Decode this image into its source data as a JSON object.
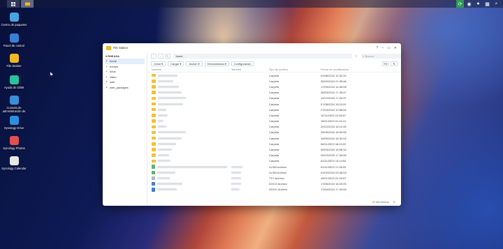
{
  "desktop": {
    "icons": [
      {
        "label": "Centro de paquetes",
        "color": "#4aa3e0"
      },
      {
        "label": "Panel de control",
        "color": "#3a7fd4"
      },
      {
        "label": "File Station",
        "color": "#f2b824"
      },
      {
        "label": "Ayuda de DSM",
        "color": "#2ac29d"
      },
      {
        "label": "Consola de administración de",
        "color": "#3b8ed8"
      },
      {
        "label": "Synology Drive",
        "color": "#2d8fdc"
      },
      {
        "label": "Synology Photos",
        "color": "#e24f4f"
      },
      {
        "label": "Synology Calendar",
        "color": "#e8e8e8"
      }
    ]
  },
  "window": {
    "title": "File Station",
    "controls": [
      "?",
      "–",
      "▭",
      "✕"
    ],
    "sidebar": {
      "root": "▾ RHEASA",
      "items": [
        "home",
        "homes",
        "fotos",
        "video",
        "web",
        "web_packages"
      ]
    },
    "path": "home",
    "search_placeholder": "Buscar",
    "toolbar": [
      "Crear ▾",
      "Cargar ▾",
      "Acción ▾",
      "Herramientas ▾",
      "Configuración"
    ],
    "columns": [
      "Nombre",
      "Tamaño",
      "Tipo de archivo",
      "Fecha de modificación"
    ],
    "rows": [
      {
        "type": "Carpeta",
        "date": "01/08/2024 10:32:20",
        "icon": "folder"
      },
      {
        "type": "Carpeta",
        "date": "26/02/2024 21:35:46",
        "icon": "folder"
      },
      {
        "type": "Carpeta",
        "date": "17/09/2024 14:45:08",
        "icon": "folder"
      },
      {
        "type": "Carpeta",
        "date": "28/03/2024 17:25:47",
        "icon": "folder"
      },
      {
        "type": "Carpeta",
        "date": "13/12/2023 17:24:37",
        "icon": "folder"
      },
      {
        "type": "Carpeta",
        "date": "07/08/2024 18:10:51",
        "icon": "folder"
      },
      {
        "type": "Carpeta",
        "date": "27/04/2024 10:58:55",
        "icon": "folder"
      },
      {
        "type": "Carpeta",
        "date": "11/11/2023 22:28:57",
        "icon": "folder"
      },
      {
        "type": "Carpeta",
        "date": "18/11/2023 01:42:21",
        "icon": "folder"
      },
      {
        "type": "Carpeta",
        "date": "20/12/2023 18:12:45",
        "icon": "folder"
      },
      {
        "type": "Carpeta",
        "date": "25/09/2024 18:00:55",
        "icon": "folder"
      },
      {
        "type": "Carpeta",
        "date": "18/09/2024 18:32:02",
        "icon": "folder"
      },
      {
        "type": "Carpeta",
        "date": "08/11/2023 18:43:22",
        "icon": "folder"
      },
      {
        "type": "Carpeta",
        "date": "05/03/2024 18:08:32",
        "icon": "folder"
      },
      {
        "type": "Carpeta",
        "date": "29/12/2023 17:34:55",
        "icon": "folder"
      },
      {
        "type": "Carpeta",
        "date": "02/11/2023 13:14:54",
        "icon": "folder"
      },
      {
        "type": "XLSM Archivo",
        "date": "01/11/2023 17:06:00",
        "icon": "doc"
      },
      {
        "type": "XLSM Archivo",
        "date": "01/02/2024 09:48:53",
        "icon": "doc"
      },
      {
        "type": "TXT Archivo",
        "date": "18/11/2023 01:26:57",
        "icon": "txt"
      },
      {
        "type": "DOCX Archivo",
        "date": "17/06/2024 16:03:05",
        "icon": "word"
      },
      {
        "type": "ODOC Archivo",
        "date": "17/04/2024 17:49:55",
        "icon": "word"
      }
    ],
    "footer": {
      "count": "21 elementos",
      "refresh": "↻"
    }
  }
}
